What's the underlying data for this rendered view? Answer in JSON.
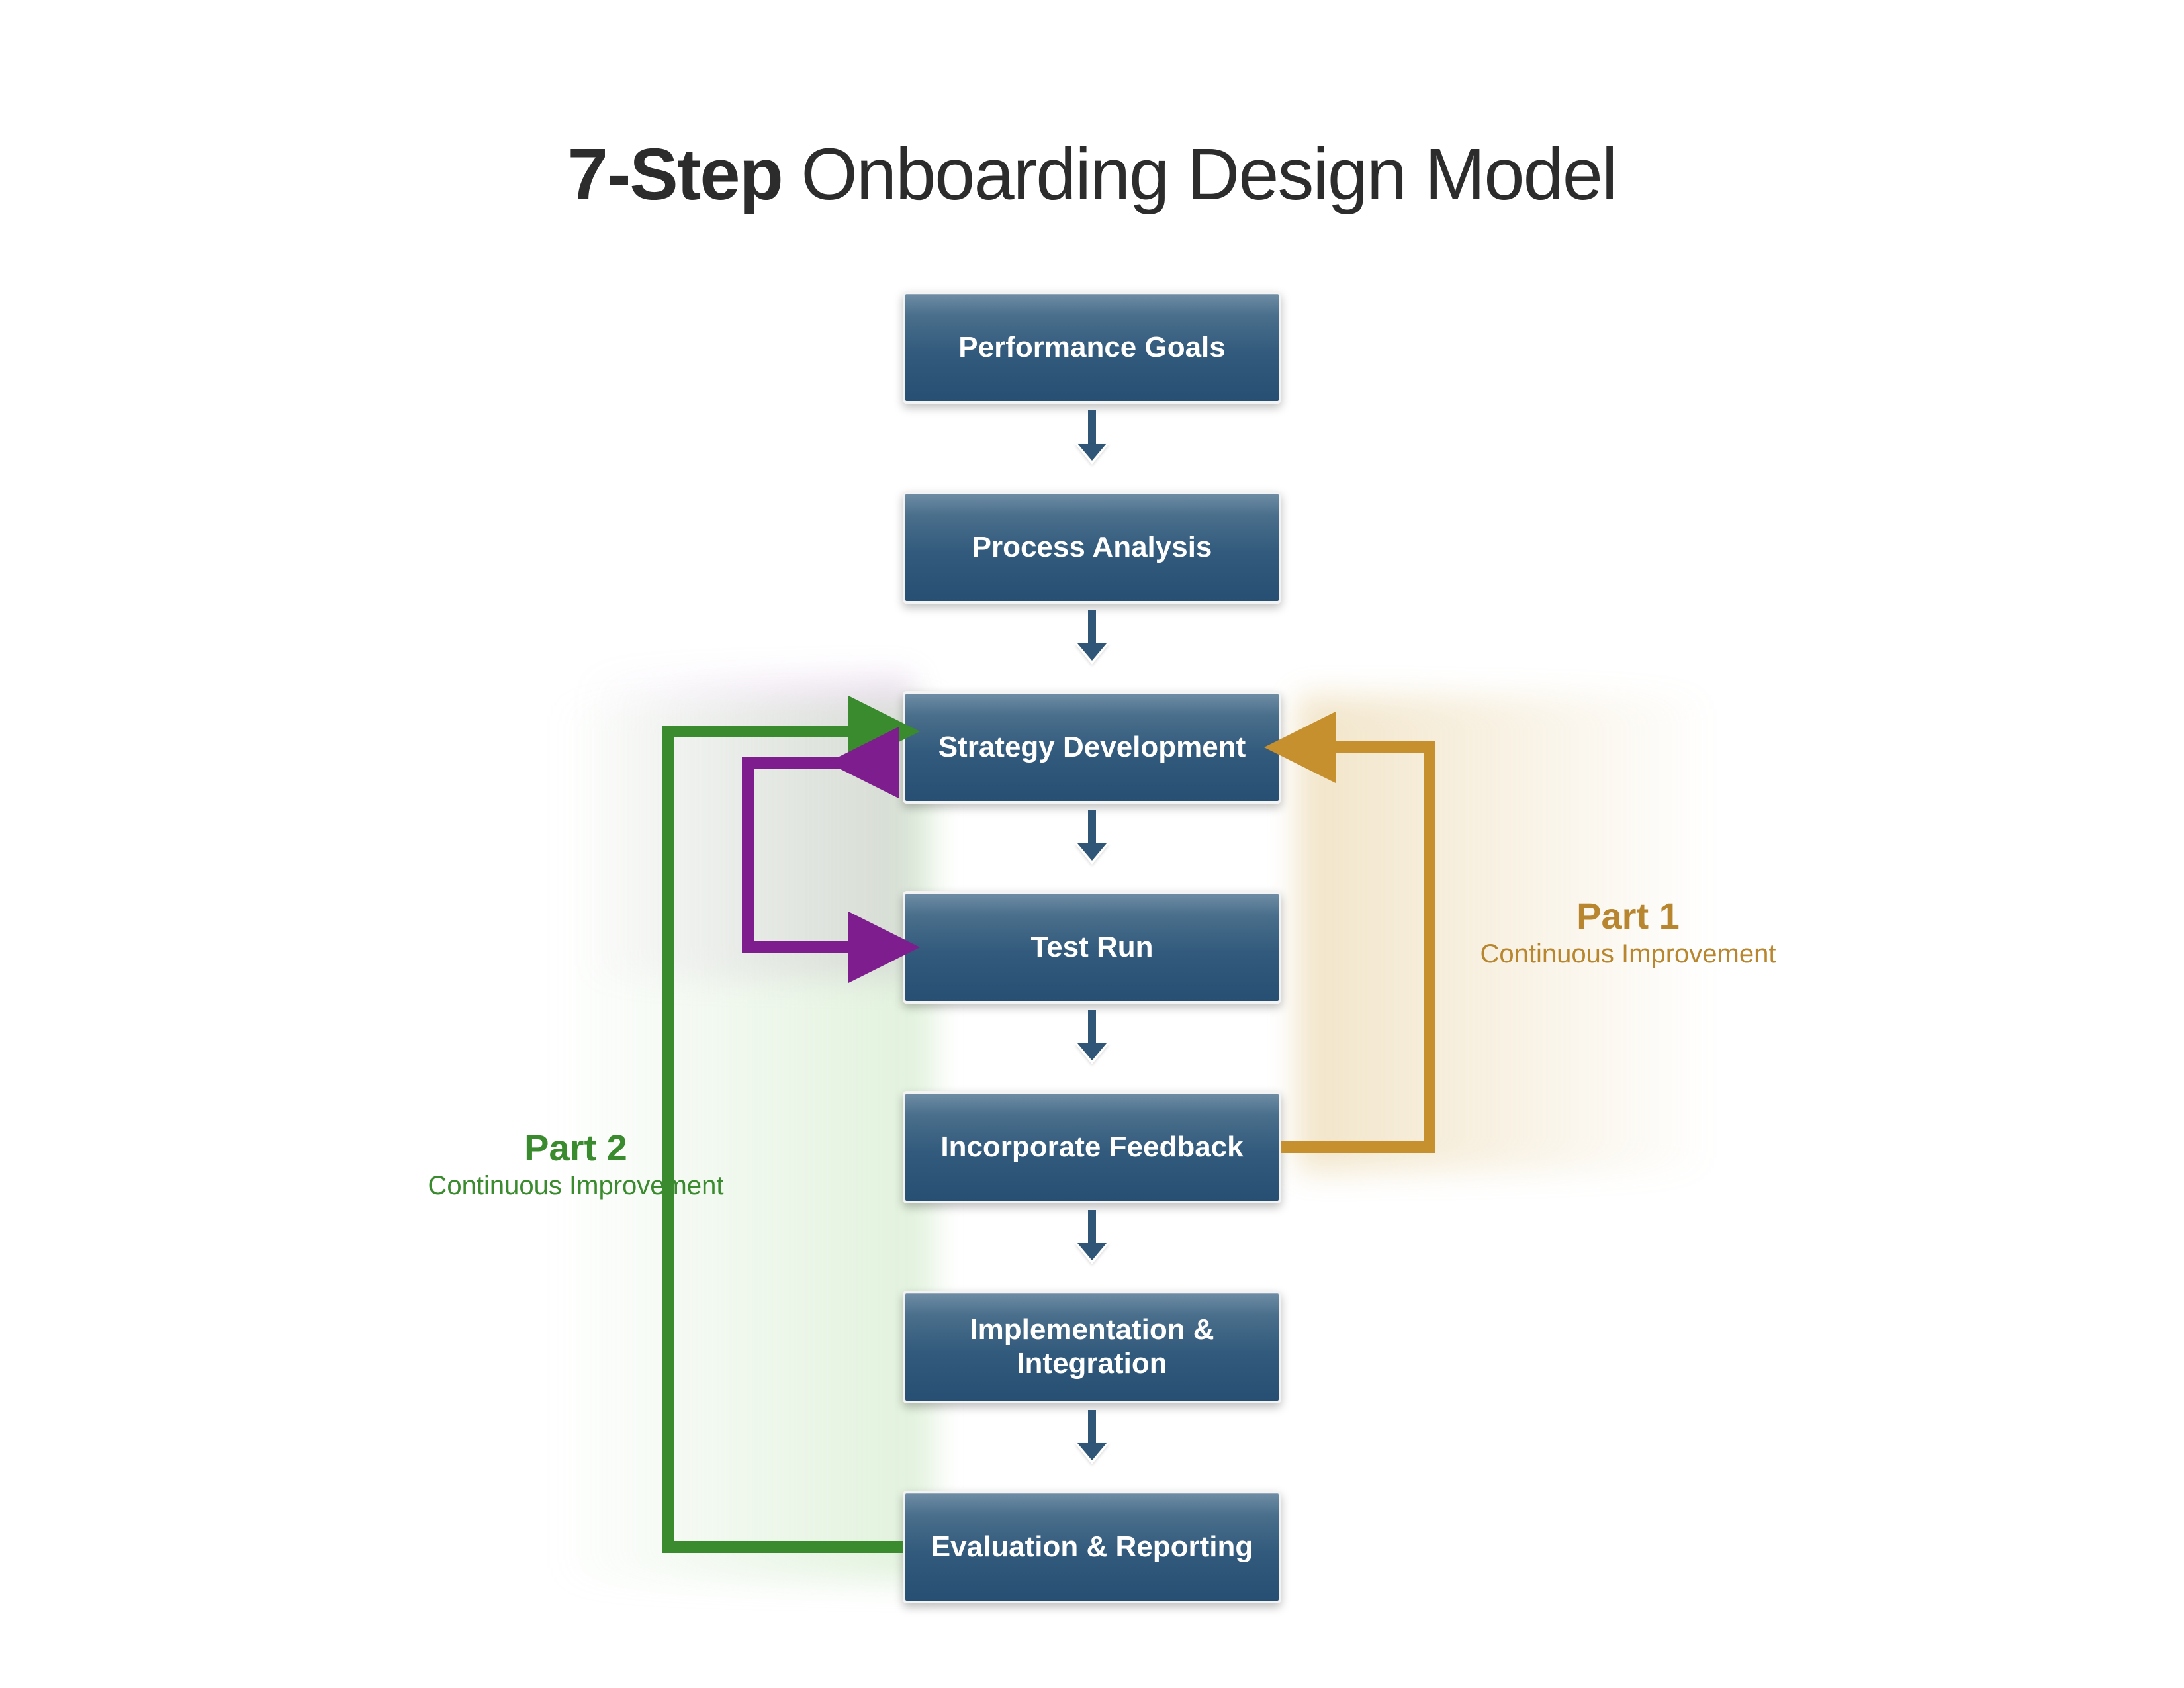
{
  "title_bold": "7-Step",
  "title_rest": " Onboarding Design Model",
  "steps": [
    "Performance Goals",
    "Process Analysis",
    "Strategy Development",
    "Test Run",
    "Incorporate Feedback",
    "Implementation & Integration",
    "Evaluation & Reporting"
  ],
  "loop1": {
    "part": "Part 1",
    "sub": "Continuous Improvement"
  },
  "loop2": {
    "part": "Part 2",
    "sub": "Continuous Improvement"
  },
  "colors": {
    "box_blue": "#325a7c",
    "arrow_blue": "#2f5676",
    "green": "#3a8a2e",
    "purple": "#7d1d8e",
    "gold": "#c6902e"
  },
  "flow": {
    "main_sequence": [
      0,
      1,
      2,
      3,
      4,
      5,
      6
    ],
    "part1_loop": {
      "from": 4,
      "to": 2,
      "side": "right",
      "label_ref": "loop1"
    },
    "part2_loop": {
      "from": 6,
      "to": 2,
      "side": "left",
      "label_ref": "loop2"
    },
    "purple_loop": {
      "between": [
        2,
        3
      ],
      "side": "left"
    }
  }
}
